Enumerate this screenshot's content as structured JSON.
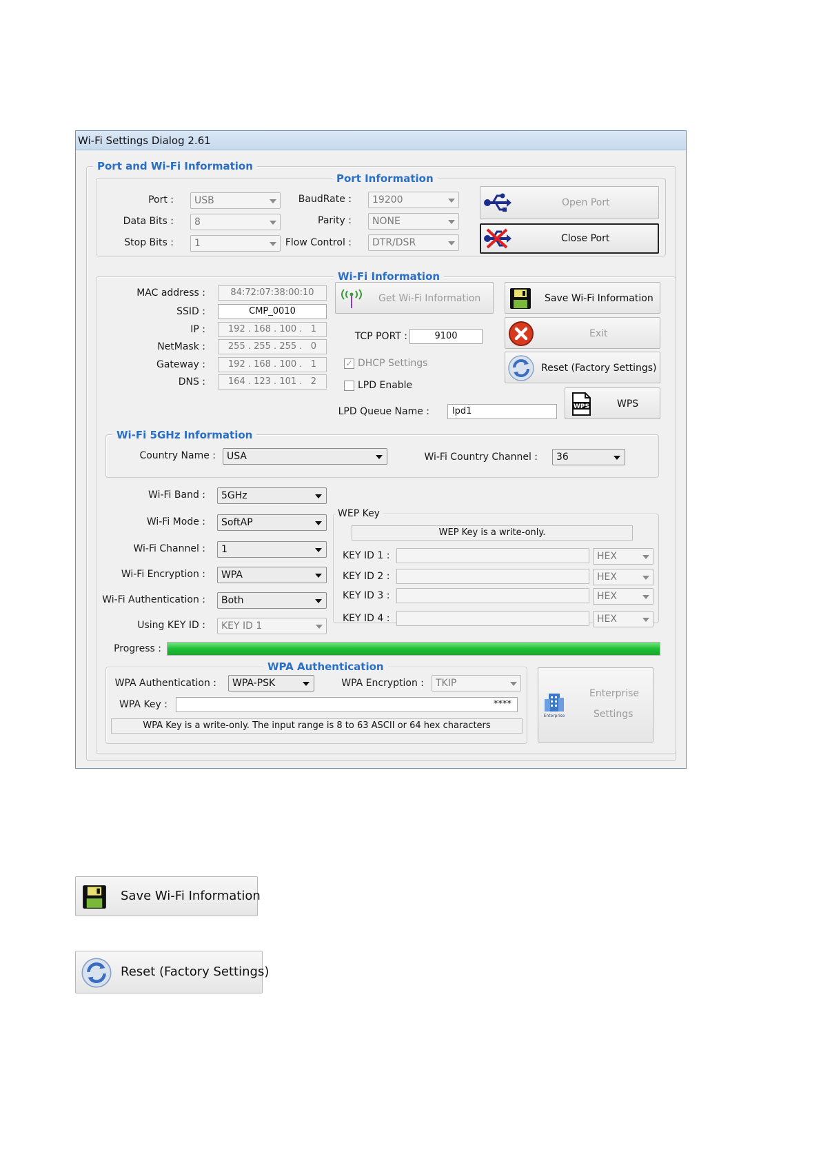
{
  "window": {
    "title": "Wi-Fi Settings Dialog 2.61"
  },
  "port_wifi_group": {
    "title": "Port and Wi-Fi Information"
  },
  "port_info": {
    "title": "Port Information",
    "port_label": "Port :",
    "port_value": "USB",
    "data_bits_label": "Data Bits :",
    "data_bits_value": "8",
    "stop_bits_label": "Stop Bits :",
    "stop_bits_value": "1",
    "baudrate_label": "BaudRate :",
    "baudrate_value": "19200",
    "parity_label": "Parity :",
    "parity_value": "NONE",
    "flow_label": "Flow Control :",
    "flow_value": "DTR/DSR",
    "open_port_label": "Open Port",
    "close_port_label": "Close Port"
  },
  "wifi_info": {
    "title": "Wi-Fi Information",
    "mac_label": "MAC address :",
    "mac_value": "84:72:07:38:00:10",
    "ssid_label": "SSID :",
    "ssid_value": "CMP_0010",
    "ip_label": "IP :",
    "ip_value": "192 . 168 . 100 .   1",
    "netmask_label": "NetMask :",
    "netmask_value": "255 . 255 . 255 .   0",
    "gateway_label": "Gateway :",
    "gateway_value": "192 . 168 . 100 .   1",
    "dns_label": "DNS :",
    "dns_value": "164 . 123 . 101 .   2",
    "get_info_label": "Get Wi-Fi Information",
    "tcp_port_label": "TCP PORT :",
    "tcp_port_value": "9100",
    "dhcp_label": "DHCP Settings",
    "lpd_enable_label": "LPD Enable",
    "lpd_queue_label": "LPD Queue Name :",
    "lpd_queue_value": "lpd1",
    "save_label": "Save Wi-Fi Information",
    "exit_label": "Exit",
    "reset_label": "Reset (Factory Settings)",
    "wps_label": "WPS",
    "wps_icon_text": "WPS"
  },
  "wifi_5ghz": {
    "title": "Wi-Fi 5GHz Information",
    "country_label": "Country Name :",
    "country_value": "USA",
    "channel_label": "Wi-Fi Country Channel :",
    "channel_value": "36"
  },
  "wifi_config": {
    "band_label": "Wi-Fi Band :",
    "band_value": "5GHz",
    "mode_label": "Wi-Fi Mode :",
    "mode_value": "SoftAP",
    "channel_label": "Wi-Fi Channel :",
    "channel_value": "1",
    "encryption_label": "Wi-Fi Encryption :",
    "encryption_value": "WPA",
    "auth_label": "Wi-Fi Authentication :",
    "auth_value": "Both",
    "key_id_label": "Using KEY ID :",
    "key_id_value": "KEY ID 1"
  },
  "wep": {
    "title": "WEP Key",
    "note": "WEP Key is a write-only.",
    "keys": [
      {
        "label": "KEY ID 1 :",
        "format": "HEX"
      },
      {
        "label": "KEY ID 2 :",
        "format": "HEX"
      },
      {
        "label": "KEY ID 3 :",
        "format": "HEX"
      },
      {
        "label": "KEY ID 4 :",
        "format": "HEX"
      }
    ]
  },
  "progress": {
    "label": "Progress :",
    "fraction": 1.0
  },
  "wpa": {
    "title": "WPA Authentication",
    "auth_label": "WPA Authentication :",
    "auth_value": "WPA-PSK",
    "encryption_label": "WPA Encryption :",
    "encryption_value": "TKIP",
    "key_label": "WPA Key :",
    "key_value": "****",
    "note": "WPA Key is a write-only. The input range is 8 to 63 ASCII or 64 hex characters",
    "enterprise_line1": "Enterprise",
    "enterprise_line2": "Settings",
    "enterprise_icon_text": "Enterprise"
  },
  "zoomed_buttons": {
    "save_label": "Save Wi-Fi Information",
    "reset_label": "Reset (Factory Settings)"
  },
  "colors": {
    "group_title": "#2a6fc4",
    "progress_green": "#1fbf36",
    "title_bar": "#c6d9ee"
  }
}
